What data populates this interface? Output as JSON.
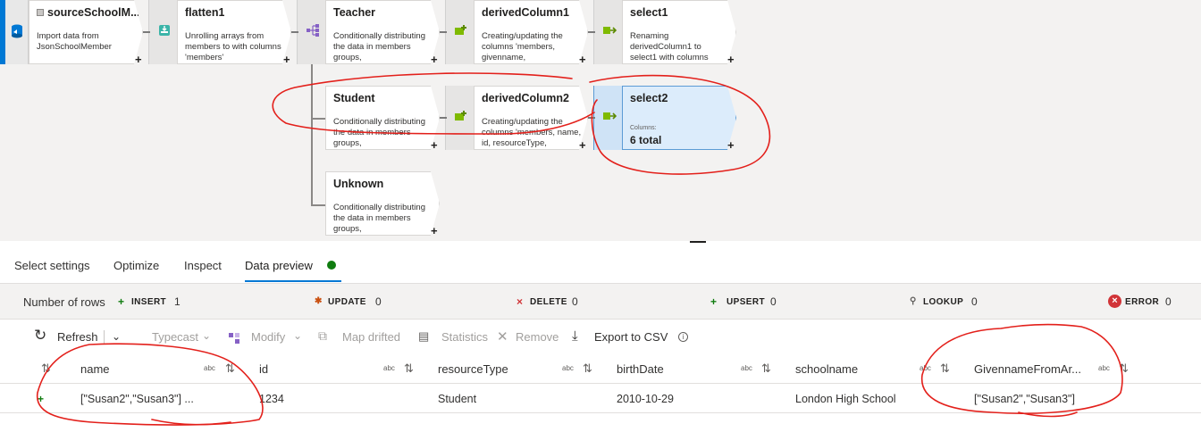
{
  "flow": {
    "nodes": [
      {
        "id": "source",
        "title": "sourceSchoolM...",
        "desc": "Import data from JsonSchoolMember"
      },
      {
        "id": "flatten",
        "title": "flatten1",
        "desc": "Unrolling arrays from members to  with columns 'members'"
      },
      {
        "id": "teacher",
        "title": "Teacher",
        "desc": "Conditionally distributing the data in members groups,"
      },
      {
        "id": "derived1",
        "title": "derivedColumn1",
        "desc": "Creating/updating the columns 'members, givenname,"
      },
      {
        "id": "select1",
        "title": "select1",
        "desc": "Renaming derivedColumn1 to select1 with columns"
      },
      {
        "id": "student",
        "title": "Student",
        "desc": "Conditionally distributing the data in members groups,"
      },
      {
        "id": "derived2",
        "title": "derivedColumn2",
        "desc": "Creating/updating the columns 'members, name, id, resourceType,"
      },
      {
        "id": "select2",
        "title": "select2",
        "sub": "Columns:",
        "big": "6 total"
      },
      {
        "id": "unknown",
        "title": "Unknown",
        "desc": "Conditionally distributing the data in members groups,"
      }
    ]
  },
  "tabs": [
    "Select settings",
    "Optimize",
    "Inspect",
    "Data preview"
  ],
  "stats": {
    "rows_label": "Number of rows",
    "insert": {
      "label": "INSERT",
      "value": "1"
    },
    "update": {
      "label": "UPDATE",
      "value": "0"
    },
    "delete": {
      "label": "DELETE",
      "value": "0"
    },
    "upsert": {
      "label": "UPSERT",
      "value": "0"
    },
    "lookup": {
      "label": "LOOKUP",
      "value": "0"
    },
    "error": {
      "label": "ERROR",
      "value": "0"
    }
  },
  "toolbar": {
    "refresh": "Refresh",
    "typecast": "Typecast",
    "modify": "Modify",
    "map_drifted": "Map drifted",
    "statistics": "Statistics",
    "remove": "Remove",
    "export": "Export to CSV"
  },
  "grid": {
    "type_label": "abc",
    "columns": [
      "name",
      "id",
      "resourceType",
      "birthDate",
      "schoolname",
      "GivennameFromAr..."
    ],
    "rows": [
      [
        "[\"Susan2\",\"Susan3\"] ...",
        "1234",
        "Student",
        "2010-10-29",
        "London High School",
        "[\"Susan2\",\"Susan3\"]"
      ]
    ]
  },
  "colors": {
    "accent": "#0078d4",
    "annotation": "#e3201b",
    "status_ok": "#107c10",
    "error": "#d13438"
  }
}
